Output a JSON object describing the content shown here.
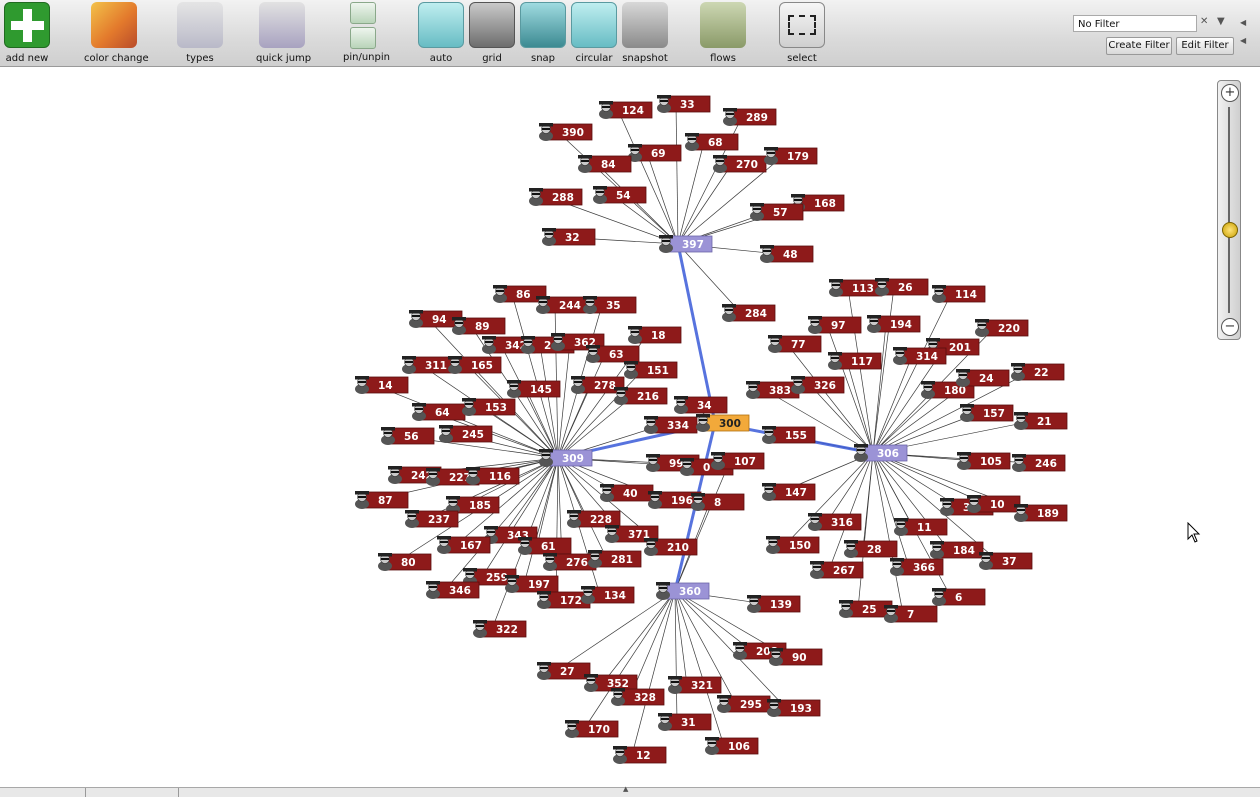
{
  "toolbar": {
    "buttons": [
      {
        "label": "add new"
      },
      {
        "label": "color change"
      },
      {
        "label": "types"
      },
      {
        "label": "quick jump"
      },
      {
        "label": "pin/unpin"
      },
      {
        "label": "auto"
      },
      {
        "label": "grid"
      },
      {
        "label": "snap"
      },
      {
        "label": "circular"
      },
      {
        "label": "snapshot"
      },
      {
        "label": "flows"
      },
      {
        "label": "select"
      }
    ],
    "filter": {
      "value": "No Filter",
      "create_label": "Create Filter",
      "edit_label": "Edit Filter"
    }
  },
  "colors": {
    "node_fill": "#8e1a1a",
    "hub_fill": "#9b93d6",
    "selected_fill": "#f2a93a",
    "edge": "#3a3a3a",
    "highlight_edge": "#3a5ad8"
  },
  "graph": {
    "hubs": [
      "397",
      "309",
      "306",
      "360"
    ],
    "selected": "300",
    "highlighted_edges": [
      [
        "397",
        "300"
      ],
      [
        "309",
        "300"
      ],
      [
        "300",
        "306"
      ],
      [
        "300",
        "360"
      ]
    ],
    "nodes": [
      {
        "id": "390",
        "hub": "397"
      },
      {
        "id": "124",
        "hub": "397"
      },
      {
        "id": "33",
        "hub": "397"
      },
      {
        "id": "289",
        "hub": "397"
      },
      {
        "id": "69",
        "hub": "397"
      },
      {
        "id": "68",
        "hub": "397"
      },
      {
        "id": "84",
        "hub": "397"
      },
      {
        "id": "270",
        "hub": "397"
      },
      {
        "id": "179",
        "hub": "397"
      },
      {
        "id": "288",
        "hub": "397"
      },
      {
        "id": "54",
        "hub": "397"
      },
      {
        "id": "168",
        "hub": "397"
      },
      {
        "id": "57",
        "hub": "397"
      },
      {
        "id": "32",
        "hub": "397"
      },
      {
        "id": "48",
        "hub": "397"
      },
      {
        "id": "284",
        "hub": "397"
      },
      {
        "id": "397",
        "hub": null
      },
      {
        "id": "86",
        "hub": "309"
      },
      {
        "id": "244",
        "hub": "309"
      },
      {
        "id": "35",
        "hub": "309"
      },
      {
        "id": "94",
        "hub": "309"
      },
      {
        "id": "89",
        "hub": "309"
      },
      {
        "id": "342",
        "hub": "309"
      },
      {
        "id": "2",
        "hub": "309"
      },
      {
        "id": "362",
        "hub": "309"
      },
      {
        "id": "18",
        "hub": "309"
      },
      {
        "id": "63",
        "hub": "309"
      },
      {
        "id": "311",
        "hub": "309"
      },
      {
        "id": "165",
        "hub": "309"
      },
      {
        "id": "151",
        "hub": "309"
      },
      {
        "id": "14",
        "hub": "309"
      },
      {
        "id": "145",
        "hub": "309"
      },
      {
        "id": "278",
        "hub": "309"
      },
      {
        "id": "216",
        "hub": "309"
      },
      {
        "id": "64",
        "hub": "309"
      },
      {
        "id": "153",
        "hub": "309"
      },
      {
        "id": "56",
        "hub": "309"
      },
      {
        "id": "245",
        "hub": "309"
      },
      {
        "id": "334",
        "hub": "309"
      },
      {
        "id": "99",
        "hub": "309"
      },
      {
        "id": "0",
        "hub": "309"
      },
      {
        "id": "242",
        "hub": "309"
      },
      {
        "id": "227",
        "hub": "309"
      },
      {
        "id": "116",
        "hub": "309"
      },
      {
        "id": "40",
        "hub": "309"
      },
      {
        "id": "196",
        "hub": "309"
      },
      {
        "id": "87",
        "hub": "309"
      },
      {
        "id": "185",
        "hub": "309"
      },
      {
        "id": "237",
        "hub": "309"
      },
      {
        "id": "228",
        "hub": "309"
      },
      {
        "id": "371",
        "hub": "309"
      },
      {
        "id": "343",
        "hub": "309"
      },
      {
        "id": "167",
        "hub": "309"
      },
      {
        "id": "61",
        "hub": "309"
      },
      {
        "id": "210",
        "hub": "309"
      },
      {
        "id": "80",
        "hub": "309"
      },
      {
        "id": "276",
        "hub": "309"
      },
      {
        "id": "281",
        "hub": "309"
      },
      {
        "id": "259",
        "hub": "309"
      },
      {
        "id": "346",
        "hub": "309"
      },
      {
        "id": "197",
        "hub": "309"
      },
      {
        "id": "172",
        "hub": "309"
      },
      {
        "id": "134",
        "hub": "309"
      },
      {
        "id": "322",
        "hub": "309"
      },
      {
        "id": "309",
        "hub": null
      },
      {
        "id": "34",
        "hub": "300"
      },
      {
        "id": "300",
        "hub": null
      },
      {
        "id": "155",
        "hub": "306"
      },
      {
        "id": "107",
        "hub": "360"
      },
      {
        "id": "8",
        "hub": "360"
      },
      {
        "id": "147",
        "hub": "306"
      },
      {
        "id": "113",
        "hub": "306"
      },
      {
        "id": "26",
        "hub": "306"
      },
      {
        "id": "114",
        "hub": "306"
      },
      {
        "id": "97",
        "hub": "306"
      },
      {
        "id": "194",
        "hub": "306"
      },
      {
        "id": "220",
        "hub": "306"
      },
      {
        "id": "77",
        "hub": "306"
      },
      {
        "id": "201",
        "hub": "306"
      },
      {
        "id": "117",
        "hub": "306"
      },
      {
        "id": "314",
        "hub": "306"
      },
      {
        "id": "22",
        "hub": "306"
      },
      {
        "id": "383",
        "hub": "306"
      },
      {
        "id": "326",
        "hub": "306"
      },
      {
        "id": "180",
        "hub": "306"
      },
      {
        "id": "24",
        "hub": "306"
      },
      {
        "id": "157",
        "hub": "306"
      },
      {
        "id": "21",
        "hub": "306"
      },
      {
        "id": "105",
        "hub": "306"
      },
      {
        "id": "246",
        "hub": "306"
      },
      {
        "id": "3",
        "hub": "306"
      },
      {
        "id": "10",
        "hub": "306"
      },
      {
        "id": "189",
        "hub": "306"
      },
      {
        "id": "316",
        "hub": "306"
      },
      {
        "id": "11",
        "hub": "306"
      },
      {
        "id": "150",
        "hub": "306"
      },
      {
        "id": "28",
        "hub": "306"
      },
      {
        "id": "184",
        "hub": "306"
      },
      {
        "id": "37",
        "hub": "306"
      },
      {
        "id": "267",
        "hub": "306"
      },
      {
        "id": "366",
        "hub": "306"
      },
      {
        "id": "6",
        "hub": "306"
      },
      {
        "id": "25",
        "hub": "306"
      },
      {
        "id": "7",
        "hub": "306"
      },
      {
        "id": "306",
        "hub": null
      },
      {
        "id": "139",
        "hub": "360"
      },
      {
        "id": "208",
        "hub": "360"
      },
      {
        "id": "90",
        "hub": "360"
      },
      {
        "id": "27",
        "hub": "360"
      },
      {
        "id": "352",
        "hub": "360"
      },
      {
        "id": "328",
        "hub": "360"
      },
      {
        "id": "321",
        "hub": "360"
      },
      {
        "id": "295",
        "hub": "360"
      },
      {
        "id": "193",
        "hub": "360"
      },
      {
        "id": "170",
        "hub": "360"
      },
      {
        "id": "31",
        "hub": "360"
      },
      {
        "id": "106",
        "hub": "360"
      },
      {
        "id": "12",
        "hub": "360"
      },
      {
        "id": "360",
        "hub": null
      }
    ]
  }
}
